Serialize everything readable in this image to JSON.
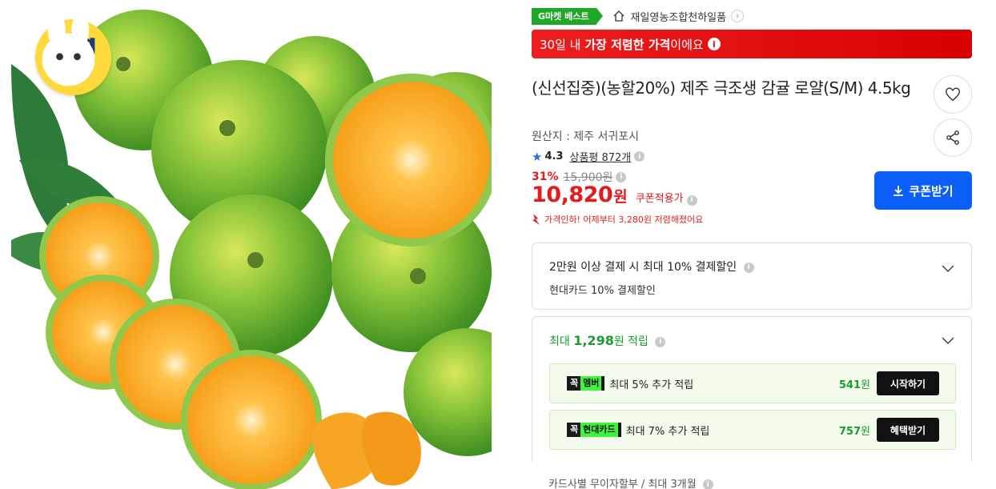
{
  "image": {
    "badge_big": "big",
    "badge_sale": "sale"
  },
  "topline": {
    "gmarket_best": "G마켓 베스트",
    "seller_name": "재일영농조합천하일품",
    "chevron": "›"
  },
  "banner": {
    "prefix": "30일 내 ",
    "highlight": "가장 저렴한 가격",
    "suffix": "이에요",
    "info": "i"
  },
  "product": {
    "title": "(신선집중)(농할20%) 제주 극조생 감귤 로얄(S/M) 4.5kg",
    "origin": "원산지 : 제주 서귀포시",
    "rating_star": "★",
    "rating_score": "4.3",
    "reviews": "상품평 872개",
    "discount_rate": "31%",
    "original_price": "15,900원",
    "price": "10,820",
    "price_unit": "원",
    "price_label": "쿠폰적용가",
    "price_drop": "가격인하! 어제부터 3,280원 저렴해졌어요"
  },
  "actions": {
    "coupon_button": "쿠폰받기"
  },
  "payment": {
    "title": "2만원 이상 결제 시 최대 10% 결제할인",
    "subtitle": "현대카드 10% 결제할인"
  },
  "reward": {
    "head_prefix": "최대 ",
    "head_amount": "1,298",
    "head_unit": "원",
    "head_suffix": " 적립",
    "rows": [
      {
        "k": "꼭",
        "name": "멤버",
        "desc": "최대 5% 추가 적립",
        "amount": "541",
        "unit": "원",
        "action": "시작하기"
      },
      {
        "k": "꼭",
        "name": "현대카드",
        "desc": "최대 7% 추가 적립",
        "amount": "757",
        "unit": "원",
        "action": "혜택받기"
      }
    ]
  },
  "installment": "카드사별 무이자할부 / 최대 3개월",
  "colors": {
    "price_red": "#e31b1b",
    "coupon_blue": "#0b5ff8",
    "reward_green": "#1c9b2f",
    "best_green": "#1fa827"
  },
  "icons": [
    "home-icon",
    "heart-icon",
    "share-icon",
    "download-icon",
    "chevron-down-icon",
    "info-icon",
    "star-icon",
    "price-down-icon"
  ]
}
